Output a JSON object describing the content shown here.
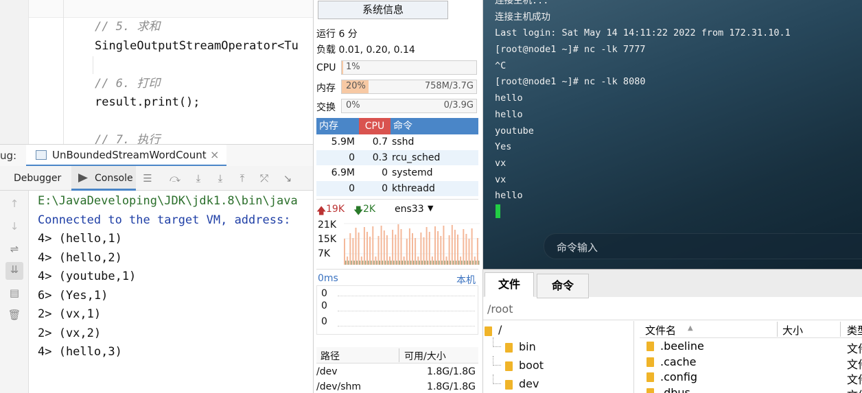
{
  "ide": {
    "code_lines": [
      {
        "text": "// 5. 求和",
        "kind": "comment"
      },
      {
        "text": "SingleOutputStreamOperator<Tu",
        "kind": "code"
      },
      {
        "text": "",
        "kind": "code"
      },
      {
        "text": "// 6. 打印",
        "kind": "comment"
      },
      {
        "text": "result.print();",
        "kind": "code"
      },
      {
        "text": "",
        "kind": "code"
      },
      {
        "text": "// 7. 执行",
        "kind": "comment"
      }
    ],
    "debug_label": "ug:",
    "run_config_tab": "UnBoundedStreamWordCount",
    "close_glyph": "×",
    "tabs": {
      "debugger": "Debugger",
      "console": "Console"
    },
    "console_lines": [
      {
        "text": "E:\\JavaDeveloping\\JDK\\jdk1.8\\bin\\java",
        "color": "#2a6e2a"
      },
      {
        "text": "Connected to the target VM, address:",
        "color": "#1f3fa6"
      },
      {
        "text": "4> (hello,1)",
        "color": "#111111"
      },
      {
        "text": "4> (hello,2)",
        "color": "#111111"
      },
      {
        "text": "4> (youtube,1)",
        "color": "#111111"
      },
      {
        "text": "6> (Yes,1)",
        "color": "#111111"
      },
      {
        "text": "2> (vx,1)",
        "color": "#111111"
      },
      {
        "text": "2> (vx,2)",
        "color": "#111111"
      },
      {
        "text": "4> (hello,3)",
        "color": "#111111"
      }
    ]
  },
  "sysinfo": {
    "button": "系统信息",
    "uptime": "运行 6 分",
    "load": "负载 0.01, 0.20, 0.14",
    "cpu": {
      "label": "CPU",
      "value": "1%",
      "fraction": 0.01
    },
    "mem": {
      "label": "内存",
      "value": "20%",
      "detail": "758M/3.7G",
      "fraction": 0.2
    },
    "swap": {
      "label": "交换",
      "value": "0%",
      "detail": "0/3.9G",
      "fraction": 0.0
    },
    "proc_headers": {
      "mem": "内存",
      "cpu": "CPU",
      "cmd": "命令"
    },
    "processes": [
      {
        "mem": "5.9M",
        "cpu": "0.7",
        "cmd": "sshd"
      },
      {
        "mem": "0",
        "cpu": "0.3",
        "cmd": "rcu_sched"
      },
      {
        "mem": "6.9M",
        "cpu": "0",
        "cmd": "systemd"
      },
      {
        "mem": "0",
        "cpu": "0",
        "cmd": "kthreadd"
      }
    ],
    "net": {
      "up": "19K",
      "down": "2K",
      "iface": "ens33",
      "y_ticks": [
        "21K",
        "15K",
        "7K"
      ]
    },
    "latency": {
      "label": "0ms",
      "host": "本机",
      "values": [
        "0",
        "0",
        "0"
      ]
    },
    "disk_headers": {
      "path": "路径",
      "size": "可用/大小"
    },
    "disks": [
      {
        "path": "/dev",
        "size": "1.8G/1.8G"
      },
      {
        "path": "/dev/shm",
        "size": "1.8G/1.8G"
      }
    ],
    "colors": {
      "accent": "#4a86c8",
      "cpu_header": "#d9534f",
      "mem_fill": "#f7c9a4",
      "bars": "#f4b89a"
    }
  },
  "terminal": {
    "lines": [
      "连接主机...",
      "连接主机成功",
      "Last login: Sat May 14 14:11:22 2022 from 172.31.10.1",
      "[root@node1 ~]# nc -lk 7777",
      "^C",
      "[root@node1 ~]# nc -lk 8080",
      "hello",
      "hello",
      "youtube",
      "Yes",
      "vx",
      "vx",
      "hello"
    ],
    "cmd_placeholder": "命令输入",
    "cursor_color": "#22cc44"
  },
  "files": {
    "tabs": [
      "文件",
      "命令"
    ],
    "path": "/root",
    "tree_root": "/",
    "tree": [
      "bin",
      "boot",
      "dev"
    ],
    "columns": {
      "name": "文件名",
      "size": "大小",
      "type": "类型"
    },
    "items": [
      {
        "name": ".beeline",
        "type": "文件"
      },
      {
        "name": ".cache",
        "type": "文件"
      },
      {
        "name": ".config",
        "type": "文件"
      },
      {
        "name": ".dbus",
        "type": "文件"
      }
    ]
  }
}
